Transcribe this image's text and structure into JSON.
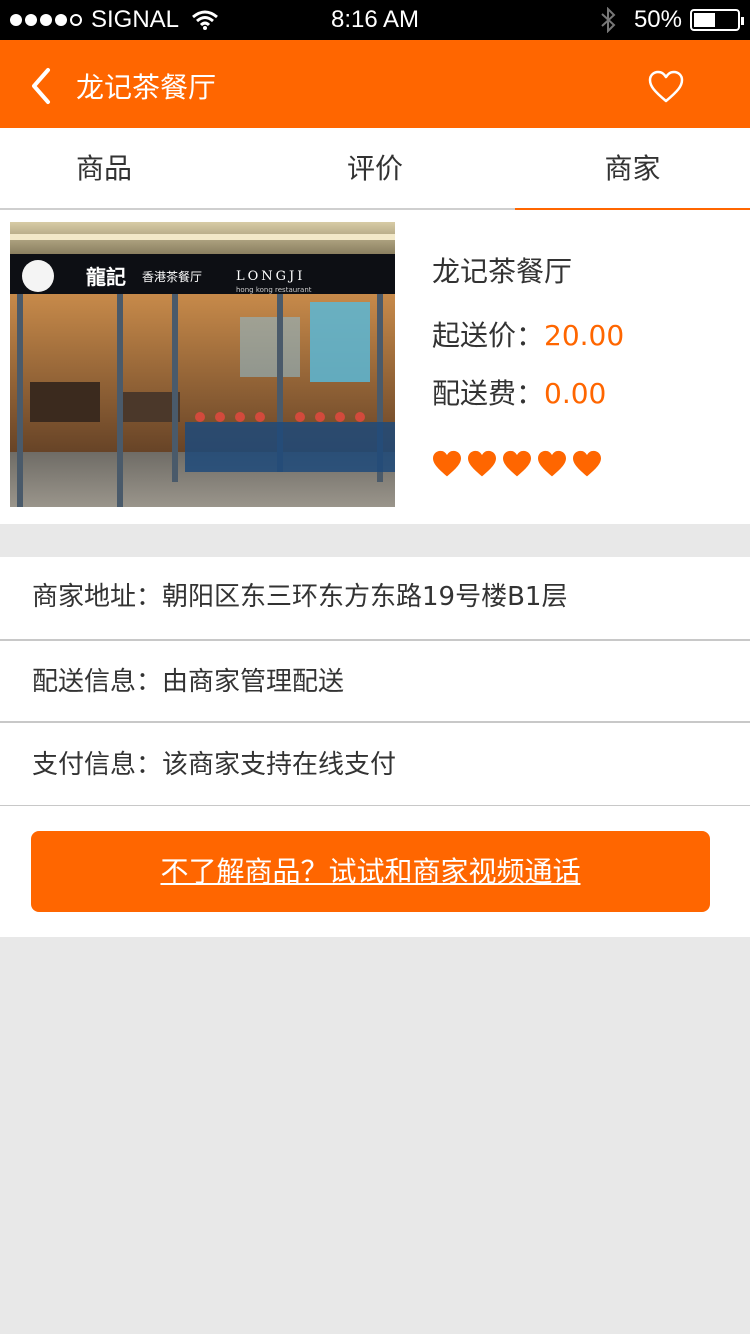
{
  "status_bar": {
    "carrier": "SIGNAL",
    "time": "8:16 AM",
    "battery_text": "50%",
    "battery_level": 0.5
  },
  "nav": {
    "title": "龙记茶餐厅"
  },
  "tabs": [
    {
      "label": "商品",
      "active": false
    },
    {
      "label": "评价",
      "active": false
    },
    {
      "label": "商家",
      "active": true
    }
  ],
  "store": {
    "name": "龙记茶餐厅",
    "min_order_label": "起送价：",
    "min_order_value": "20.00",
    "delivery_fee_label": "配送费：",
    "delivery_fee_value": "0.00",
    "rating": 5,
    "photo": {
      "sign_cn": "龍記",
      "sign_sub": "香港茶餐厅",
      "sign_en": "LONGJI",
      "sign_en_sub": "hong kong restaurant"
    }
  },
  "info": {
    "address": "商家地址：朝阳区东三环东方东路19号楼B1层",
    "delivery": "配送信息：由商家管理配送",
    "payment": "支付信息：该商家支持在线支付"
  },
  "video_call_button": "不了解商品？试试和商家视频通话",
  "colors": {
    "accent": "#ff6600",
    "background": "#e8e8e8"
  }
}
